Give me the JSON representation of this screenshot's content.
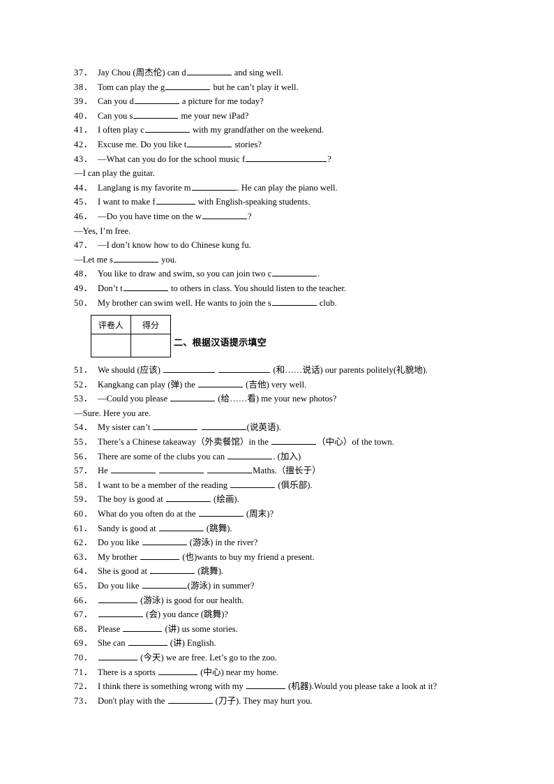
{
  "section_one": {
    "items": [
      {
        "num": "37．",
        "parts": [
          {
            "t": "text",
            "v": "Jay Chou (周杰伦) can d"
          },
          {
            "t": "blank",
            "size": "l"
          },
          {
            "t": "text",
            "v": " and sing well."
          }
        ]
      },
      {
        "num": "38．",
        "parts": [
          {
            "t": "text",
            "v": "Tom can play the g"
          },
          {
            "t": "blank",
            "size": "l"
          },
          {
            "t": "text",
            "v": " but he can’t play it well."
          }
        ]
      },
      {
        "num": "39．",
        "parts": [
          {
            "t": "text",
            "v": "Can you d"
          },
          {
            "t": "blank",
            "size": "l"
          },
          {
            "t": "text",
            "v": " a picture for me today?"
          }
        ]
      },
      {
        "num": "40．",
        "parts": [
          {
            "t": "text",
            "v": "Can you s"
          },
          {
            "t": "blank",
            "size": "l"
          },
          {
            "t": "text",
            "v": " me your new iPad?"
          }
        ]
      },
      {
        "num": "41．",
        "parts": [
          {
            "t": "text",
            "v": "I often play c"
          },
          {
            "t": "blank",
            "size": "l"
          },
          {
            "t": "text",
            "v": " with my grandfather  on the weekend."
          }
        ]
      },
      {
        "num": "42．",
        "parts": [
          {
            "t": "text",
            "v": "Excuse me. Do you like t"
          },
          {
            "t": "blank",
            "size": "l"
          },
          {
            "t": "text",
            "v": " stories?"
          }
        ]
      },
      {
        "num": "43．",
        "parts": [
          {
            "t": "text",
            "v": "—What can you do for the school music f"
          },
          {
            "t": "blank",
            "size": "xxl"
          },
          {
            "t": "text",
            "v": "?"
          }
        ]
      },
      {
        "num": "",
        "cont": true,
        "parts": [
          {
            "t": "text",
            "v": "—I can play the guitar."
          }
        ]
      },
      {
        "num": "44．",
        "parts": [
          {
            "t": "text",
            "v": "Langlang  is my favorite m"
          },
          {
            "t": "blank",
            "size": "l"
          },
          {
            "t": "text",
            "v": ". He can play the piano well."
          }
        ]
      },
      {
        "num": "45．",
        "parts": [
          {
            "t": "text",
            "v": "I want to make f"
          },
          {
            "t": "blank",
            "size": "m"
          },
          {
            "t": "text",
            "v": " with English-speaking students."
          }
        ]
      },
      {
        "num": "46．",
        "parts": [
          {
            "t": "text",
            "v": "—Do you have time  on the w"
          },
          {
            "t": "blank",
            "size": "l"
          },
          {
            "t": "text",
            "v": "?"
          }
        ]
      },
      {
        "num": "",
        "cont": true,
        "parts": [
          {
            "t": "text",
            "v": "—Yes, I’m free."
          }
        ]
      },
      {
        "num": "47．",
        "parts": [
          {
            "t": "text",
            "v": "—I don’t know how to do Chinese kung fu."
          }
        ]
      },
      {
        "num": "",
        "cont": true,
        "parts": [
          {
            "t": "text",
            "v": "—Let me s"
          },
          {
            "t": "blank",
            "size": "l"
          },
          {
            "t": "text",
            "v": " you."
          }
        ]
      },
      {
        "num": "48．",
        "parts": [
          {
            "t": "text",
            "v": "You like to draw and swim, so you can join two c"
          },
          {
            "t": "blank",
            "size": "l"
          },
          {
            "t": "text",
            "v": "."
          }
        ]
      },
      {
        "num": "49．",
        "parts": [
          {
            "t": "text",
            "v": "Don’t t"
          },
          {
            "t": "blank",
            "size": "l"
          },
          {
            "t": "text",
            "v": " to others in class. You should listen to the teacher."
          }
        ]
      },
      {
        "num": "50．",
        "parts": [
          {
            "t": "text",
            "v": "My brother can swim well. He wants to join the s"
          },
          {
            "t": "blank",
            "size": "l"
          },
          {
            "t": "text",
            "v": " club."
          }
        ]
      }
    ]
  },
  "score_table": {
    "grader_label": "评卷人",
    "score_label": "得分",
    "grader_value": "",
    "score_value": ""
  },
  "section_two": {
    "title": "二、根据汉语提示填空",
    "items": [
      {
        "num": "51．",
        "parts": [
          {
            "t": "text",
            "v": "We should (应该) "
          },
          {
            "t": "blank",
            "size": "xl"
          },
          {
            "t": "text",
            "v": " "
          },
          {
            "t": "blank",
            "size": "xl"
          },
          {
            "t": "text",
            "v": " (和……说话) our parents politely(礼貌地)."
          }
        ]
      },
      {
        "num": "52．",
        "parts": [
          {
            "t": "text",
            "v": "Kangkang can play (弹) the "
          },
          {
            "t": "blank",
            "size": "l"
          },
          {
            "t": "text",
            "v": " (吉他) very well."
          }
        ]
      },
      {
        "num": "53．",
        "parts": [
          {
            "t": "text",
            "v": "—Could you please "
          },
          {
            "t": "blank",
            "size": "l"
          },
          {
            "t": "text",
            "v": " (给……看) me your new photos?"
          }
        ]
      },
      {
        "num": "",
        "cont": true,
        "parts": [
          {
            "t": "text",
            "v": "—Sure. Here you are."
          }
        ]
      },
      {
        "num": "54．",
        "parts": [
          {
            "t": "text",
            "v": "My sister can’t "
          },
          {
            "t": "blank",
            "size": "l"
          },
          {
            "t": "text",
            "v": " "
          },
          {
            "t": "blank",
            "size": "l"
          },
          {
            "t": "text",
            "v": "(说英语)."
          }
        ]
      },
      {
        "num": "55．",
        "parts": [
          {
            "t": "text",
            "v": "There’s a Chinese takeaway（外卖餐馆）in  the "
          },
          {
            "t": "blank",
            "size": "l"
          },
          {
            "t": "text",
            "v": "（中心）of the town."
          }
        ]
      },
      {
        "num": "56．",
        "parts": [
          {
            "t": "text",
            "v": "There are some of the clubs you can "
          },
          {
            "t": "blank",
            "size": "l"
          },
          {
            "t": "text",
            "v": ". (加入)"
          }
        ]
      },
      {
        "num": "57．",
        "parts": [
          {
            "t": "text",
            "v": "He "
          },
          {
            "t": "blank",
            "size": "l"
          },
          {
            "t": "text",
            "v": " "
          },
          {
            "t": "blank",
            "size": "l"
          },
          {
            "t": "text",
            "v": " "
          },
          {
            "t": "blank",
            "size": "l"
          },
          {
            "t": "text",
            "v": "Maths.（擅长于）"
          }
        ]
      },
      {
        "num": "58．",
        "parts": [
          {
            "t": "text",
            "v": "I want to be a member  of the reading "
          },
          {
            "t": "blank",
            "size": "l"
          },
          {
            "t": "text",
            "v": " (俱乐部)."
          }
        ]
      },
      {
        "num": "59．",
        "parts": [
          {
            "t": "text",
            "v": "The boy is good at "
          },
          {
            "t": "blank",
            "size": "l"
          },
          {
            "t": "text",
            "v": " (绘画)."
          }
        ]
      },
      {
        "num": "60．",
        "parts": [
          {
            "t": "text",
            "v": "What do you often do at the "
          },
          {
            "t": "blank",
            "size": "l"
          },
          {
            "t": "text",
            "v": " (周末)?"
          }
        ]
      },
      {
        "num": "61．",
        "parts": [
          {
            "t": "text",
            "v": "Sandy is good at "
          },
          {
            "t": "blank",
            "size": "l"
          },
          {
            "t": "text",
            "v": " (跳舞)."
          }
        ]
      },
      {
        "num": "62．",
        "parts": [
          {
            "t": "text",
            "v": "Do you like "
          },
          {
            "t": "blank",
            "size": "l"
          },
          {
            "t": "text",
            "v": " (游泳) in the river?"
          }
        ]
      },
      {
        "num": "63．",
        "parts": [
          {
            "t": "text",
            "v": "My brother "
          },
          {
            "t": "blank",
            "size": "m"
          },
          {
            "t": "text",
            "v": " (也)wants to buy my friend a present."
          }
        ]
      },
      {
        "num": "64．",
        "parts": [
          {
            "t": "text",
            "v": "She is good at "
          },
          {
            "t": "blank",
            "size": "l"
          },
          {
            "t": "text",
            "v": " (跳舞)."
          }
        ]
      },
      {
        "num": "65．",
        "parts": [
          {
            "t": "text",
            "v": "Do you like "
          },
          {
            "t": "blank",
            "size": "l"
          },
          {
            "t": "text",
            "v": "(游泳) in summer?"
          }
        ]
      },
      {
        "num": "66．",
        "parts": [
          {
            "t": "blank",
            "size": "m"
          },
          {
            "t": "text",
            "v": " (游泳) is good for our health."
          }
        ]
      },
      {
        "num": "67．",
        "parts": [
          {
            "t": "blank",
            "size": "l"
          },
          {
            "t": "text",
            "v": " (会) you dance (跳舞)?"
          }
        ]
      },
      {
        "num": "68．",
        "parts": [
          {
            "t": "text",
            "v": "Please "
          },
          {
            "t": "blank",
            "size": "m"
          },
          {
            "t": "text",
            "v": " (讲) us some stories."
          }
        ]
      },
      {
        "num": "69．",
        "parts": [
          {
            "t": "text",
            "v": "She can "
          },
          {
            "t": "blank",
            "size": "m"
          },
          {
            "t": "text",
            "v": " (讲) English."
          }
        ]
      },
      {
        "num": "70．",
        "parts": [
          {
            "t": "blank",
            "size": "m"
          },
          {
            "t": "text",
            "v": " (今天) we are free. Let’s go to the zoo."
          }
        ]
      },
      {
        "num": "71．",
        "parts": [
          {
            "t": "text",
            "v": "There is a sports "
          },
          {
            "t": "blank",
            "size": "m"
          },
          {
            "t": "text",
            "v": " (中心) near my home."
          }
        ]
      },
      {
        "num": "72．",
        "parts": [
          {
            "t": "text",
            "v": "I think there is something wrong with my "
          },
          {
            "t": "blank",
            "size": "m"
          },
          {
            "t": "text",
            "v": " (机器).Would you please take a look at it?"
          }
        ]
      },
      {
        "num": "73．",
        "parts": [
          {
            "t": "text",
            "v": "Don't play with the "
          },
          {
            "t": "blank",
            "size": "l"
          },
          {
            "t": "text",
            "v": " (刀子). They may hurt you."
          }
        ]
      }
    ]
  }
}
